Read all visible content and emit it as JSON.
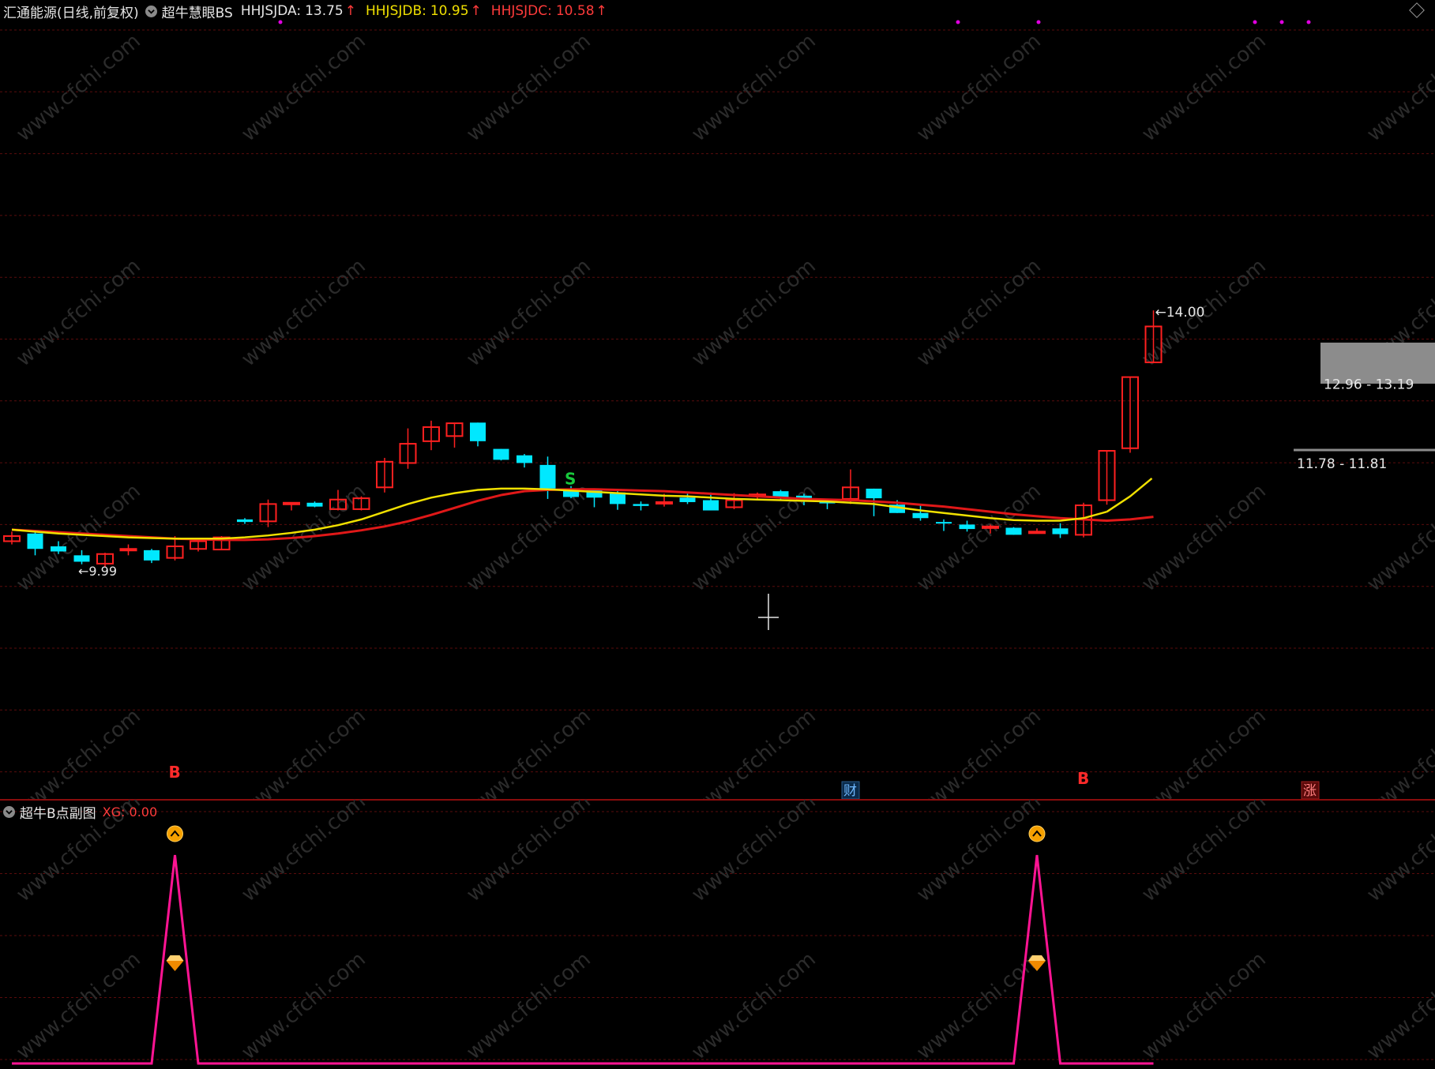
{
  "main_header": {
    "stock_title": "汇通能源(日线,前复权)",
    "indicator_name": "超牛慧眼BS",
    "items": [
      {
        "label": "HHJSJDA:",
        "value": "13.75",
        "color": "#e6e6e6"
      },
      {
        "label": "HHJSJDB:",
        "value": "10.95",
        "color": "#f0e000"
      },
      {
        "label": "HHJSJDC:",
        "value": "10.58",
        "color": "#ff3b3b"
      }
    ],
    "arrow": "↑"
  },
  "sub_header": {
    "indicator_name": "超牛B点副图",
    "xg_label": "XG: 0.00"
  },
  "annotations": {
    "high_price": "14.00",
    "low_price": "9.99",
    "range_upper": "12.96 - 13.19",
    "range_lower": "11.78 - 11.81",
    "buy_signal": "B",
    "sell_signal": "S",
    "cai_badge": "财",
    "zhang_badge": "涨"
  },
  "watermark": "www.cfchi.com",
  "colors": {
    "up": "#ff2020",
    "down": "#00e8ff",
    "ma_fast": "#f0e000",
    "ma_slow": "#e01818",
    "grid": "#5a0c0c",
    "sub_line": "#ff1493"
  },
  "chart_data": [
    {
      "type": "candlestick",
      "title": "汇通能源(日线,前复权)",
      "y_range": [
        9.6,
        14.4
      ],
      "candles": [
        {
          "o": 10.4,
          "c": 10.48,
          "h": 10.55,
          "l": 10.35
        },
        {
          "o": 10.52,
          "c": 10.28,
          "h": 10.55,
          "l": 10.18
        },
        {
          "o": 10.32,
          "c": 10.24,
          "h": 10.4,
          "l": 10.2
        },
        {
          "o": 10.18,
          "c": 10.08,
          "h": 10.26,
          "l": 10.04
        },
        {
          "o": 10.05,
          "c": 10.2,
          "h": 10.22,
          "l": 9.99
        },
        {
          "o": 10.26,
          "c": 10.28,
          "h": 10.35,
          "l": 10.18
        },
        {
          "o": 10.26,
          "c": 10.1,
          "h": 10.28,
          "l": 10.06
        },
        {
          "o": 10.14,
          "c": 10.32,
          "h": 10.48,
          "l": 10.1
        },
        {
          "o": 10.28,
          "c": 10.4,
          "h": 10.42,
          "l": 10.24
        },
        {
          "o": 10.27,
          "c": 10.46,
          "h": 10.48,
          "l": 10.26
        },
        {
          "o": 10.74,
          "c": 10.7,
          "h": 10.76,
          "l": 10.67
        },
        {
          "o": 10.71,
          "c": 10.98,
          "h": 11.05,
          "l": 10.62
        },
        {
          "o": 10.98,
          "c": 11.0,
          "h": 11.0,
          "l": 10.88
        },
        {
          "o": 11.0,
          "c": 10.94,
          "h": 11.02,
          "l": 10.93
        },
        {
          "o": 10.9,
          "c": 11.05,
          "h": 11.2,
          "l": 10.88
        },
        {
          "o": 10.9,
          "c": 11.07,
          "h": 11.1,
          "l": 10.88
        },
        {
          "o": 11.24,
          "c": 11.64,
          "h": 11.7,
          "l": 11.16
        },
        {
          "o": 11.62,
          "c": 11.92,
          "h": 12.16,
          "l": 11.53
        },
        {
          "o": 11.96,
          "c": 12.18,
          "h": 12.28,
          "l": 11.82
        },
        {
          "o": 12.04,
          "c": 12.24,
          "h": 12.25,
          "l": 11.86
        },
        {
          "o": 12.25,
          "c": 11.96,
          "h": 12.25,
          "l": 11.88
        },
        {
          "o": 11.84,
          "c": 11.67,
          "h": 11.84,
          "l": 11.66
        },
        {
          "o": 11.74,
          "c": 11.62,
          "h": 11.76,
          "l": 11.55
        },
        {
          "o": 11.59,
          "c": 11.22,
          "h": 11.72,
          "l": 11.06
        },
        {
          "o": 11.22,
          "c": 11.09,
          "h": 11.26,
          "l": 11.07
        },
        {
          "o": 11.2,
          "c": 11.08,
          "h": 11.2,
          "l": 10.93
        },
        {
          "o": 11.16,
          "c": 10.98,
          "h": 11.18,
          "l": 10.89
        },
        {
          "o": 10.98,
          "c": 10.95,
          "h": 11.02,
          "l": 10.88
        },
        {
          "o": 11.01,
          "c": 11.01,
          "h": 11.14,
          "l": 10.94
        },
        {
          "o": 11.08,
          "c": 11.01,
          "h": 11.14,
          "l": 10.98
        },
        {
          "o": 11.04,
          "c": 10.88,
          "h": 11.16,
          "l": 10.88
        },
        {
          "o": 10.93,
          "c": 11.04,
          "h": 11.15,
          "l": 10.9
        },
        {
          "o": 11.12,
          "c": 11.13,
          "h": 11.16,
          "l": 11.05
        },
        {
          "o": 11.18,
          "c": 11.08,
          "h": 11.2,
          "l": 11.04
        },
        {
          "o": 11.11,
          "c": 11.04,
          "h": 11.14,
          "l": 10.96
        },
        {
          "o": 11.06,
          "c": 10.99,
          "h": 11.06,
          "l": 10.9
        },
        {
          "o": 11.06,
          "c": 11.24,
          "h": 11.52,
          "l": 10.98
        },
        {
          "o": 11.22,
          "c": 11.07,
          "h": 11.22,
          "l": 10.79
        },
        {
          "o": 10.97,
          "c": 10.84,
          "h": 11.04,
          "l": 10.84
        },
        {
          "o": 10.84,
          "c": 10.76,
          "h": 10.96,
          "l": 10.72
        },
        {
          "o": 10.7,
          "c": 10.69,
          "h": 10.74,
          "l": 10.56
        },
        {
          "o": 10.66,
          "c": 10.59,
          "h": 10.72,
          "l": 10.55
        },
        {
          "o": 10.63,
          "c": 10.63,
          "h": 10.66,
          "l": 10.52
        },
        {
          "o": 10.61,
          "c": 10.5,
          "h": 10.62,
          "l": 10.5
        },
        {
          "o": 10.55,
          "c": 10.55,
          "h": 10.6,
          "l": 10.53
        },
        {
          "o": 10.6,
          "c": 10.51,
          "h": 10.68,
          "l": 10.45
        },
        {
          "o": 10.5,
          "c": 10.96,
          "h": 11.0,
          "l": 10.46
        },
        {
          "o": 11.04,
          "c": 11.81,
          "h": 11.81,
          "l": 10.97
        },
        {
          "o": 11.85,
          "c": 12.96,
          "h": 12.96,
          "l": 11.78
        },
        {
          "o": 13.19,
          "c": 13.75,
          "h": 14.0,
          "l": 13.19
        }
      ],
      "ma_fast": [
        10.58,
        10.55,
        10.52,
        10.5,
        10.48,
        10.46,
        10.45,
        10.44,
        10.44,
        10.44,
        10.46,
        10.49,
        10.53,
        10.58,
        10.65,
        10.74,
        10.86,
        10.98,
        11.08,
        11.15,
        11.2,
        11.22,
        11.22,
        11.21,
        11.19,
        11.17,
        11.15,
        11.13,
        11.11,
        11.1,
        11.08,
        11.06,
        11.05,
        11.04,
        11.03,
        11.02,
        11.0,
        10.98,
        10.93,
        10.88,
        10.84,
        10.8,
        10.76,
        10.73,
        10.72,
        10.72,
        10.76,
        10.86,
        null,
        null
      ],
      "ma_slow": [
        10.58,
        10.56,
        10.54,
        10.52,
        10.5,
        10.48,
        10.46,
        10.44,
        10.43,
        10.42,
        10.42,
        10.43,
        10.45,
        10.48,
        10.52,
        10.57,
        10.63,
        10.71,
        10.81,
        10.92,
        11.03,
        11.12,
        11.18,
        11.2,
        11.21,
        11.21,
        11.2,
        11.19,
        11.18,
        11.16,
        11.14,
        11.12,
        11.1,
        11.08,
        11.06,
        11.05,
        11.04,
        11.02,
        11.0,
        10.97,
        10.94,
        10.9,
        10.86,
        10.82,
        10.79,
        10.76,
        10.74,
        10.72,
        10.74,
        10.78
      ]
    },
    {
      "type": "line",
      "title": "超牛B点副图",
      "series": [
        {
          "name": "XG",
          "x": [
            6,
            7,
            8,
            43,
            44,
            45
          ],
          "values": [
            0,
            1,
            0,
            0,
            1,
            0
          ]
        }
      ],
      "y_range": [
        0,
        1
      ]
    }
  ]
}
